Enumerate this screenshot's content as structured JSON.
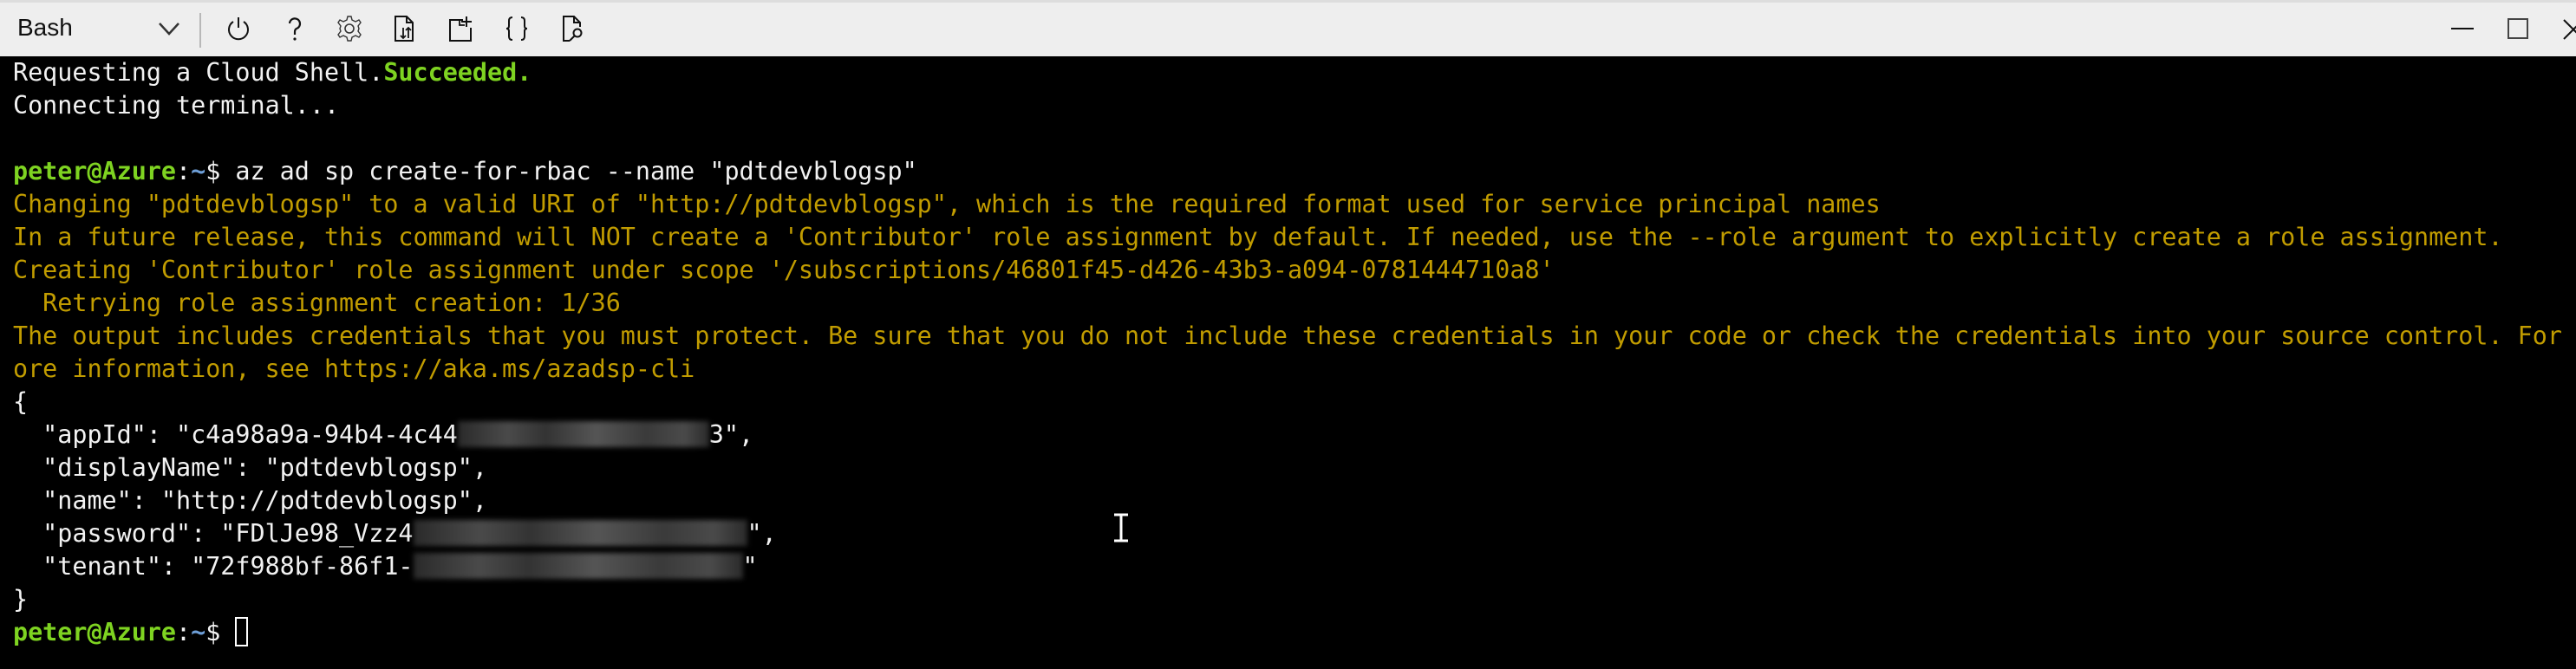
{
  "toolbar": {
    "shell_selector": {
      "value": "Bash",
      "icon": "chevron-down-icon"
    },
    "buttons": [
      {
        "name": "restart",
        "icon": "power-icon",
        "tooltip": "Restart"
      },
      {
        "name": "help",
        "icon": "help-icon",
        "tooltip": "Help"
      },
      {
        "name": "settings",
        "icon": "gear-icon",
        "tooltip": "Settings"
      },
      {
        "name": "upload-download",
        "icon": "upload-download-icon",
        "tooltip": "Upload/Download files"
      },
      {
        "name": "new-session",
        "icon": "new-session-icon",
        "tooltip": "Open new session"
      },
      {
        "name": "editor",
        "icon": "braces-icon",
        "tooltip": "Open editor"
      },
      {
        "name": "web-preview",
        "icon": "web-preview-icon",
        "tooltip": "Web preview"
      }
    ],
    "window_controls": [
      {
        "name": "minimize",
        "icon": "minimize-icon"
      },
      {
        "name": "maximize",
        "icon": "maximize-icon"
      },
      {
        "name": "close",
        "icon": "close-icon"
      }
    ]
  },
  "colors": {
    "background": "#000000",
    "text": "#f2f2f2",
    "warning": "#c19c00",
    "prompt_user": "#7ed321",
    "prompt_path": "#6e9fd8",
    "toolbar_bg": "#eeeeee"
  },
  "terminal": {
    "line1": {
      "text": "Requesting a Cloud Shell.",
      "status": "Succeeded."
    },
    "line2": "Connecting terminal...",
    "prompt": {
      "user_host": "peter@Azure",
      "colon": ":",
      "path": "~",
      "dollar": "$ "
    },
    "command": "az ad sp create-for-rbac --name \"pdtdevblogsp\"",
    "warnings": [
      "Changing \"pdtdevblogsp\" to a valid URI of \"http://pdtdevblogsp\", which is the required format used for service principal names",
      "In a future release, this command will NOT create a 'Contributor' role assignment by default. If needed, use the --role argument to explicitly create a role assignment.",
      "Creating 'Contributor' role assignment under scope '/subscriptions/46801f45-d426-43b3-a094-0781444710a8'",
      "  Retrying role assignment creation: 1/36",
      "The output includes credentials that you must protect. Be sure that you do not include these credentials in your code or check the credentials into your source control. For m",
      "ore information, see https://aka.ms/azadsp-cli"
    ],
    "json_open": "{",
    "json_close": "}",
    "output": {
      "appId": {
        "key": "  \"appId\": ",
        "prefix": "\"c4a98a9a-94b4-4c44",
        "suffix": "3\",",
        "redacted": true
      },
      "displayName": {
        "line": "  \"displayName\": \"pdtdevblogsp\","
      },
      "name": {
        "line": "  \"name\": \"http://pdtdevblogsp\","
      },
      "password": {
        "key": "  \"password\": ",
        "prefix": "\"FDlJe98_Vzz4",
        "suffix": "\",",
        "redacted": true
      },
      "tenant": {
        "key": "  \"tenant\": ",
        "prefix": "\"72f988bf-86f1-",
        "suffix": "\"",
        "redacted": true
      }
    }
  }
}
